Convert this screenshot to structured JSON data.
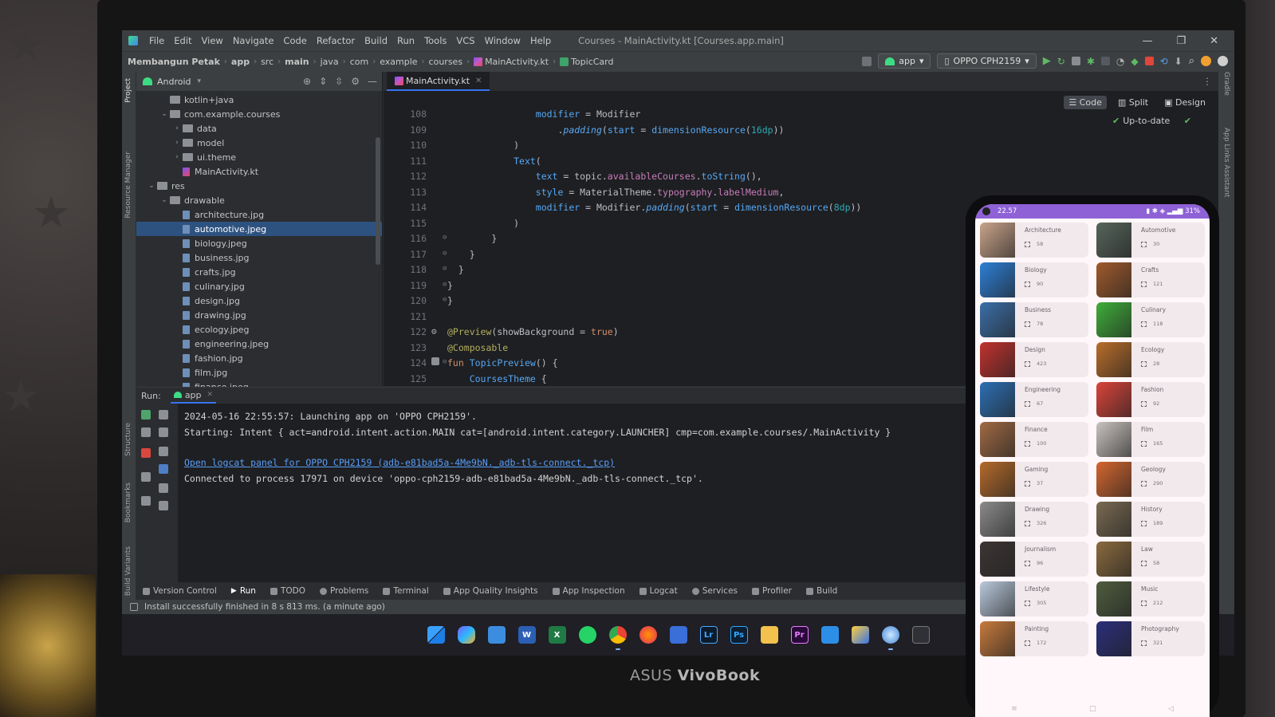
{
  "window": {
    "menu": [
      "File",
      "Edit",
      "View",
      "Navigate",
      "Code",
      "Refactor",
      "Build",
      "Run",
      "Tools",
      "VCS",
      "Window",
      "Help"
    ],
    "title": "Courses - MainActivity.kt [Courses.app.main]"
  },
  "navbar": {
    "crumbs": [
      "Membangun Petak",
      "app",
      "src",
      "main",
      "java",
      "com",
      "example",
      "courses",
      "MainActivity.kt",
      "TopicCard"
    ],
    "run_config": "app",
    "device": "OPPO CPH2159"
  },
  "project_panel": {
    "view_mode": "Android",
    "tree": [
      {
        "label": "kotlin+java",
        "depth": 2,
        "type": "folder",
        "caret": ""
      },
      {
        "label": "com.example.courses",
        "depth": 2,
        "type": "folder",
        "caret": "v"
      },
      {
        "label": "data",
        "depth": 3,
        "type": "folder",
        "caret": ">"
      },
      {
        "label": "model",
        "depth": 3,
        "type": "folder",
        "caret": ">"
      },
      {
        "label": "ui.theme",
        "depth": 3,
        "type": "folder",
        "caret": ">"
      },
      {
        "label": "MainActivity.kt",
        "depth": 3,
        "type": "kt",
        "caret": ""
      },
      {
        "label": "res",
        "depth": 1,
        "type": "folder",
        "caret": "v"
      },
      {
        "label": "drawable",
        "depth": 2,
        "type": "folder",
        "caret": "v"
      },
      {
        "label": "architecture.jpg",
        "depth": 3,
        "type": "file",
        "caret": ""
      },
      {
        "label": "automotive.jpeg",
        "depth": 3,
        "type": "file",
        "caret": "",
        "selected": true
      },
      {
        "label": "biology.jpeg",
        "depth": 3,
        "type": "file",
        "caret": ""
      },
      {
        "label": "business.jpg",
        "depth": 3,
        "type": "file",
        "caret": ""
      },
      {
        "label": "crafts.jpg",
        "depth": 3,
        "type": "file",
        "caret": ""
      },
      {
        "label": "culinary.jpg",
        "depth": 3,
        "type": "file",
        "caret": ""
      },
      {
        "label": "design.jpg",
        "depth": 3,
        "type": "file",
        "caret": ""
      },
      {
        "label": "drawing.jpg",
        "depth": 3,
        "type": "file",
        "caret": ""
      },
      {
        "label": "ecology.jpeg",
        "depth": 3,
        "type": "file",
        "caret": ""
      },
      {
        "label": "engineering.jpeg",
        "depth": 3,
        "type": "file",
        "caret": ""
      },
      {
        "label": "fashion.jpg",
        "depth": 3,
        "type": "file",
        "caret": ""
      },
      {
        "label": "film.jpg",
        "depth": 3,
        "type": "file",
        "caret": ""
      },
      {
        "label": "finance.jpeg",
        "depth": 3,
        "type": "file",
        "caret": ""
      },
      {
        "label": "gaming.jpg",
        "depth": 3,
        "type": "file",
        "caret": ""
      }
    ]
  },
  "editor": {
    "tab": "MainActivity.kt",
    "views": [
      "Code",
      "Split",
      "Design"
    ],
    "status": "Up-to-date",
    "lines": [
      {
        "n": "108",
        "html": "                <span class=\"param\">modifier</span> = Modifier"
      },
      {
        "n": "109",
        "html": "                    .<span class=\"it\">padding</span>(<span class=\"param\">start</span> = <span class=\"fn\">dimensionResource</span>(<span class=\"num\">16dp</span>))"
      },
      {
        "n": "110",
        "html": "            )"
      },
      {
        "n": "111",
        "html": "            <span class=\"fn\">Text</span>("
      },
      {
        "n": "112",
        "html": "                <span class=\"param\">text</span> = topic.<span class=\"prop\">availableCourses</span>.<span class=\"fn\">toString</span>(),"
      },
      {
        "n": "113",
        "html": "                <span class=\"param\">style</span> = MaterialTheme.<span class=\"prop\">typography</span>.<span class=\"prop\">labelMedium</span>,"
      },
      {
        "n": "114",
        "html": "                <span class=\"param\">modifier</span> = Modifier.<span class=\"it\">padding</span>(<span class=\"param\">start</span> = <span class=\"fn\">dimensionResource</span>(<span class=\"num\">8dp</span>))"
      },
      {
        "n": "115",
        "html": "            )"
      },
      {
        "n": "116",
        "html": "        }"
      },
      {
        "n": "117",
        "html": "    }"
      },
      {
        "n": "118",
        "html": "  }"
      },
      {
        "n": "119",
        "html": "}"
      },
      {
        "n": "120",
        "html": "}"
      },
      {
        "n": "121",
        "html": ""
      },
      {
        "n": "122",
        "html": "<span class=\"ann\">@Preview</span>(showBackground = <span class=\"kw\">true</span>)"
      },
      {
        "n": "123",
        "html": "<span class=\"ann\">@Composable</span>"
      },
      {
        "n": "124",
        "html": "<span class=\"kw\">fun</span> <span class=\"fn\">TopicPreview</span>() {"
      },
      {
        "n": "125",
        "html": "    <span class=\"fn\">CoursesTheme</span> {"
      }
    ]
  },
  "run": {
    "label": "Run:",
    "tab": "app",
    "console": [
      "2024-05-16 22:55:57: Launching app on 'OPPO CPH2159'.",
      "Starting: Intent { act=android.intent.action.MAIN cat=[android.intent.category.LAUNCHER] cmp=com.example.courses/.MainActivity }",
      "",
      "Open logcat panel for OPPO CPH2159 (adb-e81bad5a-4Me9bN._adb-tls-connect._tcp)",
      "Connected to process 17971 on device 'oppo-cph2159-adb-e81bad5a-4Me9bN._adb-tls-connect._tcp'."
    ]
  },
  "tool_tabs": [
    "Version Control",
    "Run",
    "TODO",
    "Problems",
    "Terminal",
    "App Quality Insights",
    "App Inspection",
    "Logcat",
    "Services",
    "Profiler",
    "Build"
  ],
  "side_labels": {
    "project": "Project",
    "resource_manager": "Resource Manager",
    "structure": "Structure",
    "bookmarks": "Bookmarks",
    "build_variants": "Build Variants",
    "gradle": "Gradle",
    "app_links": "App Links Assistant"
  },
  "statusbar": {
    "message": "Install successfully finished in 8 s 813 ms. (a minute ago)"
  },
  "laptop": {
    "brand": "ASUS",
    "model": "VivoBook"
  },
  "phone": {
    "time": "22.57",
    "battery": "31%",
    "topics": [
      {
        "name": "Architecture",
        "count": "58",
        "color": "#c9a48a"
      },
      {
        "name": "Automotive",
        "count": "30",
        "color": "#56655c"
      },
      {
        "name": "Biology",
        "count": "90",
        "color": "#2d7fd6"
      },
      {
        "name": "Crafts",
        "count": "121",
        "color": "#a05a2c"
      },
      {
        "name": "Business",
        "count": "78",
        "color": "#3b6fa8"
      },
      {
        "name": "Culinary",
        "count": "118",
        "color": "#3fae3a"
      },
      {
        "name": "Design",
        "count": "423",
        "color": "#c0322e"
      },
      {
        "name": "Ecology",
        "count": "28",
        "color": "#b86d2a"
      },
      {
        "name": "Engineering",
        "count": "67",
        "color": "#2c6fb4"
      },
      {
        "name": "Fashion",
        "count": "92",
        "color": "#d9443a"
      },
      {
        "name": "Finance",
        "count": "100",
        "color": "#a06a44"
      },
      {
        "name": "Film",
        "count": "165",
        "color": "#c9c3bf"
      },
      {
        "name": "Gaming",
        "count": "37",
        "color": "#b56a2a"
      },
      {
        "name": "Geology",
        "count": "290",
        "color": "#d4662e"
      },
      {
        "name": "Drawing",
        "count": "326",
        "color": "#8b8b8b"
      },
      {
        "name": "History",
        "count": "189",
        "color": "#7a6a52"
      },
      {
        "name": "Journalism",
        "count": "96",
        "color": "#3c3534"
      },
      {
        "name": "Law",
        "count": "58",
        "color": "#8a6a3e"
      },
      {
        "name": "Lifestyle",
        "count": "305",
        "color": "#b9c9dc"
      },
      {
        "name": "Music",
        "count": "212",
        "color": "#4e5d3e"
      },
      {
        "name": "Painting",
        "count": "172",
        "color": "#c77a3c"
      },
      {
        "name": "Photography",
        "count": "321",
        "color": "#2a2e7a"
      }
    ]
  }
}
